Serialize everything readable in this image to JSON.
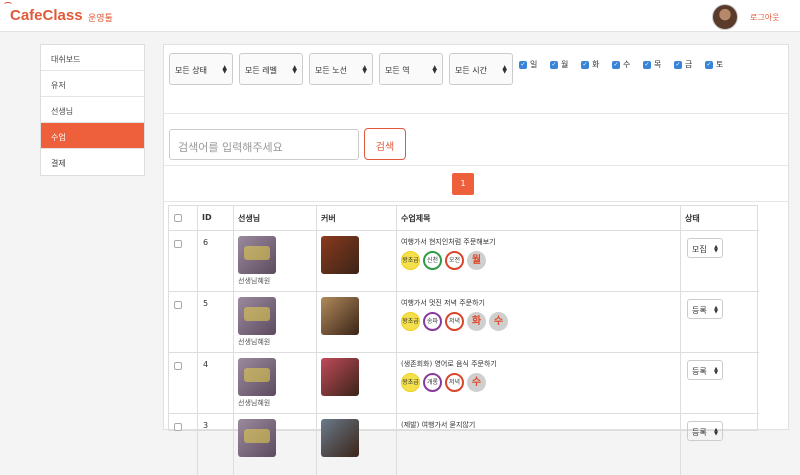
{
  "header": {
    "logo": "CafeClass",
    "nav_link": "운영툴",
    "logout": "로그아웃"
  },
  "sidebar": {
    "items": [
      {
        "label": "대쉬보드",
        "active": false
      },
      {
        "label": "유저",
        "active": false
      },
      {
        "label": "선생님",
        "active": false
      },
      {
        "label": "수업",
        "active": true
      },
      {
        "label": "결제",
        "active": false
      }
    ]
  },
  "filters": {
    "selects": [
      "모든 상태",
      "모든 레벨",
      "모든 노선",
      "모든 역",
      "모든 시간"
    ],
    "days": [
      "일",
      "월",
      "화",
      "수",
      "목",
      "금",
      "토"
    ]
  },
  "search": {
    "placeholder": "검색어를 입력해주세요",
    "button": "검색"
  },
  "pagination": {
    "current": "1"
  },
  "table": {
    "headers": [
      "ID",
      "선생님",
      "커버",
      "수업제목",
      "상태"
    ],
    "rows": [
      {
        "id": "6",
        "teacher": "선생님혜원",
        "title": "여행가서 현지인처럼 주문해보기",
        "badges": [
          [
            "level",
            "왕초급"
          ],
          [
            "green",
            "신천"
          ],
          [
            "red",
            "오전"
          ],
          [
            "day",
            "월"
          ]
        ],
        "status": "모집",
        "cover": "#8a3a1e"
      },
      {
        "id": "5",
        "teacher": "선생님혜원",
        "title": "여행가서 멋진 저녁 주문하기",
        "badges": [
          [
            "level",
            "왕초급"
          ],
          [
            "purple",
            "송파"
          ],
          [
            "red",
            "저녁"
          ],
          [
            "day",
            "화"
          ],
          [
            "day",
            "수"
          ]
        ],
        "status": "등록",
        "cover": "#b08a5a"
      },
      {
        "id": "4",
        "teacher": "선생님혜원",
        "title": "(생존회화) 영어로 음식 주문하기",
        "badges": [
          [
            "level",
            "왕초급"
          ],
          [
            "purple",
            "개롱"
          ],
          [
            "red",
            "저녁"
          ],
          [
            "day",
            "수"
          ]
        ],
        "status": "등록",
        "cover": "#c04a5a"
      },
      {
        "id": "3",
        "teacher": "",
        "title": "(제발) 여행가서 묻지않기",
        "badges": [],
        "status": "등록",
        "cover": "#6a7a8a"
      }
    ]
  }
}
